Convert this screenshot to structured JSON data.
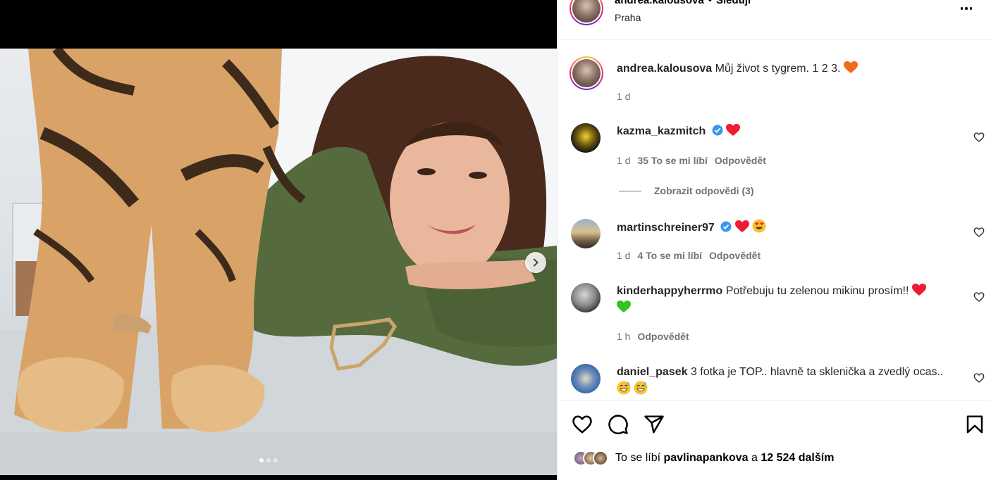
{
  "post": {
    "username": "andrea.kalousova",
    "separator": "•",
    "follow_label": "Sleduji",
    "location": "Praha"
  },
  "caption": {
    "username": "andrea.kalousova",
    "text": "Můj život s tygrem. 1 2 3.",
    "emoji": "orange-heart",
    "time": "1 d"
  },
  "comments": [
    {
      "username": "kazma_kazmitch",
      "verified": true,
      "text": "",
      "emojis": [
        "red-heart"
      ],
      "time": "1 d",
      "likes": "35 To se mi líbí",
      "reply": "Odpovědět",
      "view_replies": "Zobrazit odpovědi (3)"
    },
    {
      "username": "martinschreiner97",
      "verified": true,
      "text": "",
      "emojis": [
        "red-heart",
        "heart-eyes"
      ],
      "time": "1 d",
      "likes": "4 To se mi líbí",
      "reply": "Odpovědět"
    },
    {
      "username": "kinderhappyherrmo",
      "verified": false,
      "text": "Potřebuju tu zelenou mikinu prosím!!",
      "emojis": [
        "red-heart",
        "green-heart"
      ],
      "time": "1 h",
      "reply": "Odpovědět"
    },
    {
      "username": "daniel_pasek",
      "verified": false,
      "text": "3 fotka je TOP.. hlavně ta sklenička a zvedlý ocas..",
      "emojis": [
        "grinning-sweat",
        "grinning-sweat"
      ]
    }
  ],
  "likes": {
    "prefix": "To se líbí",
    "user": "pavlinapankova",
    "and": "a",
    "others": "12 524 dalším"
  },
  "carousel": {
    "slides": 3,
    "current": 1
  },
  "colors": {
    "accent": "#0095f6",
    "muted": "#737373",
    "heart_red": "#ed1c34",
    "heart_orange": "#f26a1b",
    "heart_green": "#34c41f",
    "verified_blue": "#3897f0"
  },
  "icons": [
    "more-icon",
    "chevron-right-icon",
    "heart-icon",
    "comment-icon",
    "share-icon",
    "bookmark-icon",
    "verified-icon"
  ]
}
